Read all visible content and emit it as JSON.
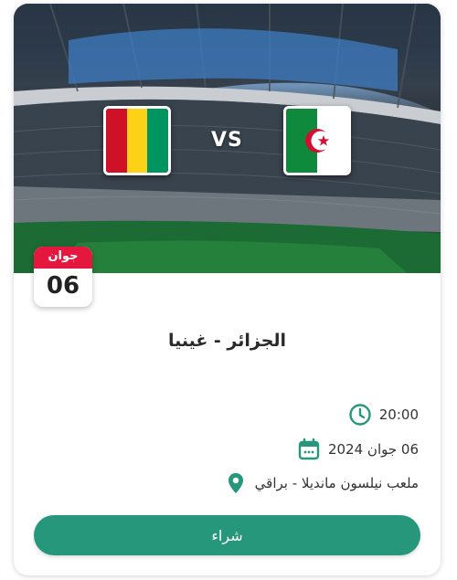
{
  "match": {
    "home_flag": "guinea-flag",
    "away_flag": "algeria-flag",
    "vs_label": "VS",
    "title": "الجزائر - غينيا"
  },
  "date_badge": {
    "month": "جوان",
    "day": "06"
  },
  "details": {
    "time": "20:00",
    "date": "06 جوان 2024",
    "venue": "ملعب نيلسون مانديلا - براقي"
  },
  "action": {
    "buy_label": "شراء"
  },
  "colors": {
    "accent": "#26977a",
    "badge_red": "#e5173f"
  }
}
